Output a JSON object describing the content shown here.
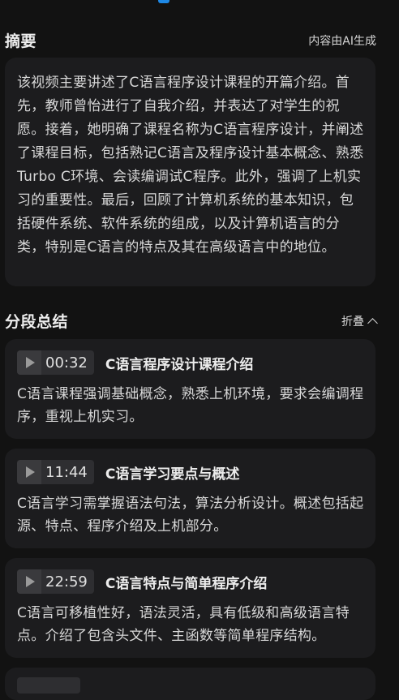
{
  "summary": {
    "title": "摘要",
    "source_note": "内容由AI生成",
    "text": "该视频主要讲述了C语言程序设计课程的开篇介绍。首先，教师曾怡进行了自我介绍，并表达了对学生的祝愿。接着，她明确了课程名称为C语言程序设计，并阐述了课程目标，包括熟记C语言及程序设计基本概念、熟悉Turbo C环境、会读编调试C程序。此外，强调了上机实习的重要性。最后，回顾了计算机系统的基本知识，包括硬件系统、软件系统的组成，以及计算机语言的分类，特别是C语言的特点及其在高级语言中的地位。"
  },
  "segments_section": {
    "title": "分段总结",
    "collapse_label": "折叠"
  },
  "segments": [
    {
      "time": "00:32",
      "title": "C语言程序设计课程介绍",
      "desc": "C语言课程强调基础概念，熟悉上机环境，要求会编调程序，重视上机实习。"
    },
    {
      "time": "11:44",
      "title": "C语言学习要点与概述",
      "desc": "C语言学习需掌握语法句法，算法分析设计。概述包括起源、特点、程序介绍及上机部分。"
    },
    {
      "time": "22:59",
      "title": "C语言特点与简单程序介绍",
      "desc": "C语言可移植性好，语法灵活，具有低级和高级语言特点。介绍了包含头文件、主函数等简单程序结构。"
    }
  ]
}
